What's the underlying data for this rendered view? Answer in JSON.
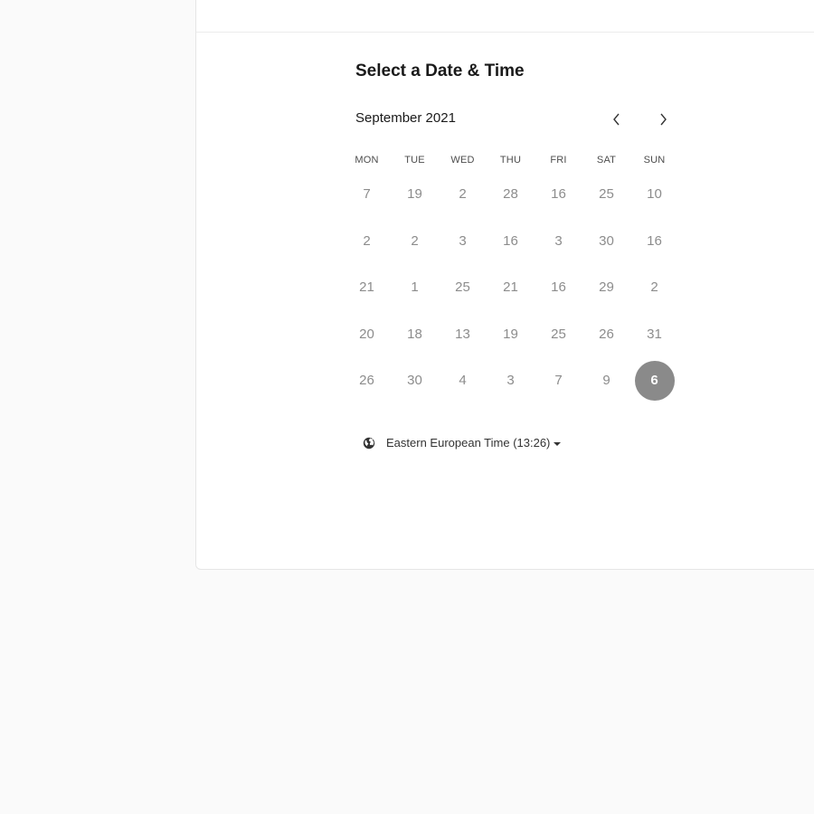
{
  "scheduler": {
    "title": "Select a Date & Time",
    "month": "September 2021",
    "nav": {
      "prev_icon": "chevron-left-icon",
      "next_icon": "chevron-right-icon"
    },
    "weekdays": [
      "MON",
      "TUE",
      "WED",
      "THU",
      "FRI",
      "SAT",
      "SUN"
    ],
    "weeks": [
      [
        "7",
        "19",
        "2",
        "28",
        "16",
        "25",
        "10"
      ],
      [
        "2",
        "2",
        "3",
        "16",
        "3",
        "30",
        "16"
      ],
      [
        "21",
        "1",
        "25",
        "21",
        "16",
        "29",
        "2"
      ],
      [
        "20",
        "18",
        "13",
        "19",
        "25",
        "26",
        "31"
      ],
      [
        "26",
        "30",
        "4",
        "3",
        "7",
        "9",
        "6"
      ]
    ],
    "selected_day": "6",
    "timezone": {
      "icon": "globe-icon",
      "label": "Eastern European Time (13:26)"
    }
  },
  "colors": {
    "page_background": "#fafafa",
    "panel_background": "#ffffff",
    "day_text": "#8c8c8c",
    "selected_day_background": "#8a8a8a",
    "selected_day_text": "#ffffff"
  }
}
